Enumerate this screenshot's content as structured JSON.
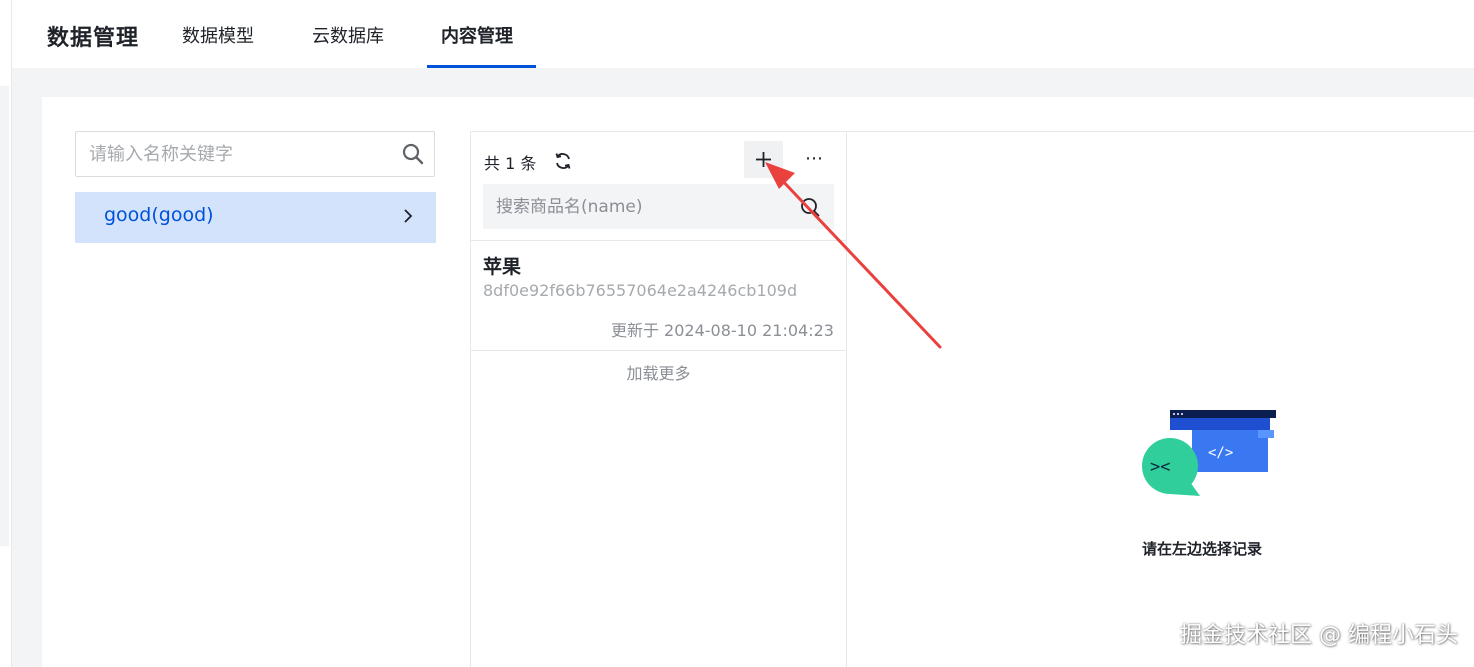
{
  "topbar": {
    "brand": "数据管理",
    "tabs": [
      {
        "label": "数据模型"
      },
      {
        "label": "云数据库"
      },
      {
        "label": "内容管理",
        "active": true
      }
    ]
  },
  "sidebar": {
    "search_placeholder": "请输入名称关键字",
    "collections": [
      {
        "label": "good(good)",
        "selected": true
      }
    ]
  },
  "list": {
    "count_label": "共 1 条",
    "search_placeholder": "搜索商品名(name)",
    "records": [
      {
        "title": "苹果",
        "id": "8df0e92f66b76557064e2a4246cb109d",
        "updated": "更新于 2024-08-10 21:04:23"
      }
    ],
    "load_more": "加载更多",
    "more_glyph": "⋯"
  },
  "detail": {
    "empty_text": "请在左边选择记录"
  },
  "watermark": "掘金技术社区 @ 编程小石头",
  "colors": {
    "accent": "#0052d9",
    "selected_bg": "#d4e3fc",
    "annotation_arrow": "#e8413e"
  }
}
